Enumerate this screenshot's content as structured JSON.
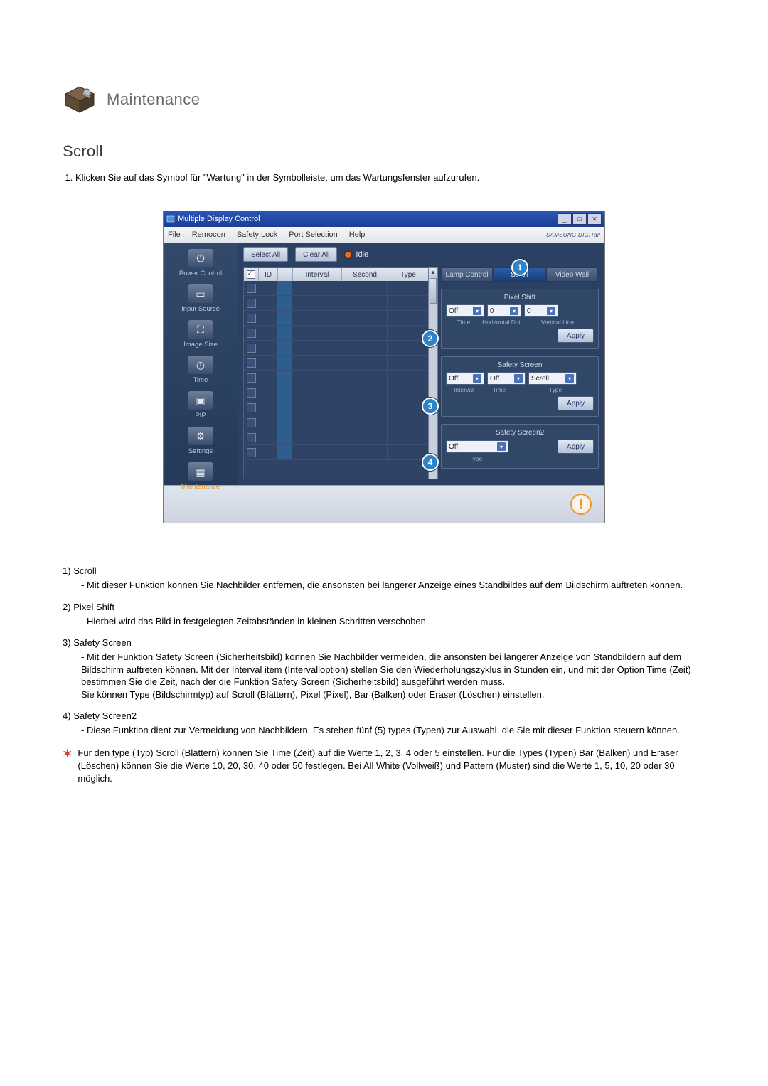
{
  "header": {
    "title": "Maintenance"
  },
  "section": {
    "title": "Scroll"
  },
  "intro_steps": [
    "Klicken Sie auf das Symbol für \"Wartung\" in der Symbolleiste, um das Wartungsfenster aufzurufen."
  ],
  "app": {
    "title": "Multiple Display Control",
    "brand": "SAMSUNG DIGITall",
    "menu": [
      "File",
      "Remocon",
      "Safety Lock",
      "Port Selection",
      "Help"
    ],
    "toolbar": {
      "select_all": "Select All",
      "clear_all": "Clear All",
      "idle": "Idle"
    },
    "sidebar": [
      {
        "label": "Power Control"
      },
      {
        "label": "Input Source"
      },
      {
        "label": "Image Size"
      },
      {
        "label": "Time"
      },
      {
        "label": "PIP"
      },
      {
        "label": "Settings"
      },
      {
        "label": "Maintenance"
      }
    ],
    "grid_headers": {
      "id": "ID",
      "interval": "Interval",
      "second": "Second",
      "type": "Type"
    },
    "tabs": {
      "lamp": "Lamp Control",
      "scroll": "Scroll",
      "videowall": "Video Wall"
    },
    "callouts": {
      "1": "1",
      "2": "2",
      "3": "3",
      "4": "4"
    },
    "panels": {
      "pixel_shift": {
        "title": "Pixel Shift",
        "onoff": "Off",
        "hdot": "0",
        "vline": "0",
        "labels": {
          "time": "Time",
          "hdot": "Horizontal Dot",
          "vline": "Vertical Line"
        },
        "apply": "Apply"
      },
      "safety_screen": {
        "title": "Safety Screen",
        "onoff": "Off",
        "interval_val": "Off",
        "type_val": "Scroll",
        "labels": {
          "interval": "Interval",
          "time": "Time",
          "type": "Type"
        },
        "apply": "Apply"
      },
      "safety_screen2": {
        "title": "Safety Screen2",
        "onoff": "Off",
        "labels": {
          "type": "Type"
        },
        "apply": "Apply"
      }
    }
  },
  "explanations": [
    {
      "num": "1)",
      "title": "Scroll",
      "body": "- Mit dieser Funktion können Sie Nachbilder entfernen, die ansonsten bei längerer Anzeige eines Standbildes auf dem Bildschirm auftreten können."
    },
    {
      "num": "2)",
      "title": "Pixel Shift",
      "body": "- Hierbei wird das Bild in festgelegten Zeitabständen in kleinen Schritten verschoben."
    },
    {
      "num": "3)",
      "title": "Safety Screen",
      "body": "- Mit der Funktion Safety Screen (Sicherheitsbild) können Sie Nachbilder vermeiden, die ansonsten bei längerer Anzeige von Standbildern auf dem Bildschirm auftreten können.  Mit der Interval item (Intervalloption) stellen Sie den Wiederholungszyklus in Stunden ein, und mit der Option Time (Zeit) bestimmen Sie die Zeit, nach der die Funktion Safety Screen (Sicherheitsbild) ausgeführt werden muss.\nSie können Type (Bildschirmtyp) auf Scroll (Blättern), Pixel (Pixel), Bar (Balken) oder Eraser (Löschen) einstellen."
    },
    {
      "num": "4)",
      "title": "Safety Screen2",
      "body": "- Diese Funktion dient zur Vermeidung von Nachbildern. Es stehen fünf (5) types (Typen) zur Auswahl, die Sie mit dieser Funktion steuern können."
    }
  ],
  "star_note": "Für den type (Typ) Scroll (Blättern) können Sie Time (Zeit) auf die Werte 1, 2, 3, 4 oder 5 einstellen. Für die Types (Typen) Bar (Balken) und Eraser (Löschen) können Sie die Werte 10, 20, 30, 40 oder 50 festlegen. Bei All White (Vollweiß) und Pattern (Muster) sind die Werte 1, 5, 10, 20 oder 30 möglich."
}
